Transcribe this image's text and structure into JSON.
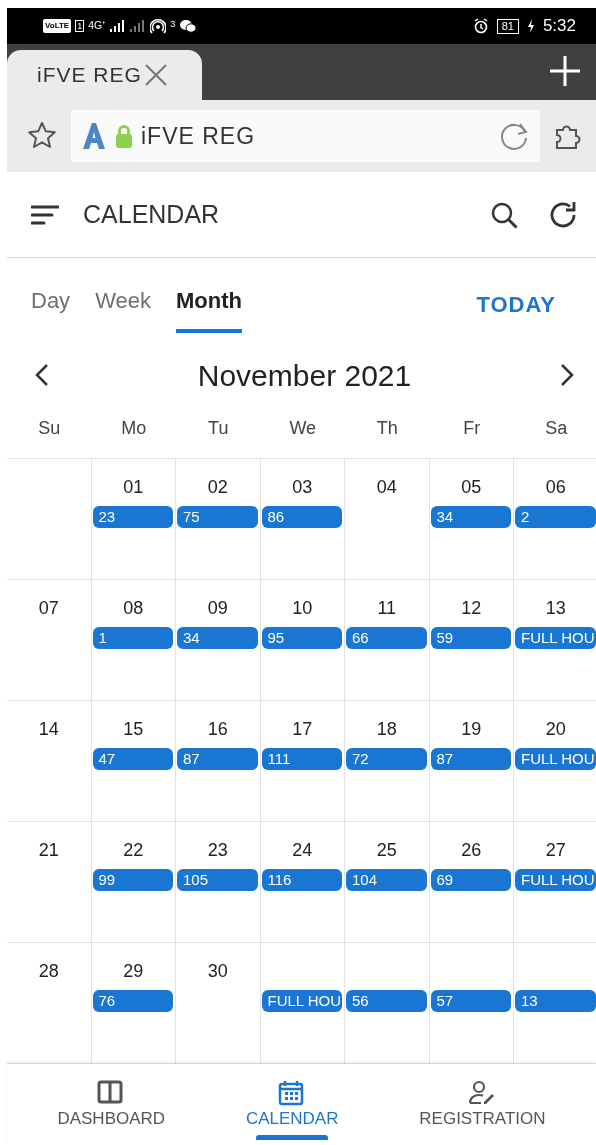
{
  "status_bar": {
    "volte": "VoLTE",
    "sim": "1",
    "network": "4G⁺",
    "hotspot_count": "3",
    "battery": "81",
    "time": "5:32"
  },
  "browser": {
    "tab_title": "iFVE REG",
    "address": "iFVE REG"
  },
  "app_bar": {
    "title": "CALENDAR"
  },
  "view_tabs": [
    {
      "label": "Day",
      "selected": false
    },
    {
      "label": "Week",
      "selected": false
    },
    {
      "label": "Month",
      "selected": true
    }
  ],
  "today_button": "TODAY",
  "month_title": "November 2021",
  "weekdays": [
    "Su",
    "Mo",
    "Tu",
    "We",
    "Th",
    "Fr",
    "Sa"
  ],
  "weeks": [
    [
      {
        "kind": "blank"
      },
      {
        "kind": "day",
        "date": "01",
        "event": "23"
      },
      {
        "kind": "day",
        "date": "02",
        "event": "75"
      },
      {
        "kind": "day",
        "date": "03",
        "event": "86"
      },
      {
        "kind": "day",
        "date": "04"
      },
      {
        "kind": "day",
        "date": "05",
        "event": "34"
      },
      {
        "kind": "day",
        "date": "06",
        "event": "2"
      }
    ],
    [
      {
        "kind": "day",
        "date": "07"
      },
      {
        "kind": "day",
        "date": "08",
        "event": "1"
      },
      {
        "kind": "day",
        "date": "09",
        "event": "34"
      },
      {
        "kind": "day",
        "date": "10",
        "event": "95"
      },
      {
        "kind": "day",
        "date": "11",
        "event": "66"
      },
      {
        "kind": "day",
        "date": "12",
        "event": "59"
      },
      {
        "kind": "day",
        "date": "13",
        "event": "FULL HOU"
      }
    ],
    [
      {
        "kind": "day",
        "date": "14"
      },
      {
        "kind": "day",
        "date": "15",
        "event": "47"
      },
      {
        "kind": "day",
        "date": "16",
        "event": "87"
      },
      {
        "kind": "day",
        "date": "17",
        "event": "111"
      },
      {
        "kind": "day",
        "date": "18",
        "event": "72"
      },
      {
        "kind": "day",
        "date": "19",
        "event": "87"
      },
      {
        "kind": "day",
        "date": "20",
        "event": "FULL HOU"
      }
    ],
    [
      {
        "kind": "day",
        "date": "21"
      },
      {
        "kind": "day",
        "date": "22",
        "event": "99"
      },
      {
        "kind": "day",
        "date": "23",
        "event": "105"
      },
      {
        "kind": "day",
        "date": "24",
        "event": "116"
      },
      {
        "kind": "day",
        "date": "25",
        "event": "104"
      },
      {
        "kind": "day",
        "date": "26",
        "event": "69"
      },
      {
        "kind": "day",
        "date": "27",
        "event": "FULL HOU"
      }
    ],
    [
      {
        "kind": "day",
        "date": "28"
      },
      {
        "kind": "day",
        "date": "29",
        "event": "76"
      },
      {
        "kind": "day",
        "date": "30"
      },
      {
        "kind": "overflow",
        "event": "FULL HOU"
      },
      {
        "kind": "overflow",
        "event": "56"
      },
      {
        "kind": "overflow",
        "event": "57"
      },
      {
        "kind": "overflow",
        "event": "13"
      }
    ]
  ],
  "bottom_nav": [
    {
      "kind": "dashboard",
      "label": "DASHBOARD",
      "selected": false
    },
    {
      "kind": "calendar",
      "label": "CALENDAR",
      "selected": true
    },
    {
      "kind": "registration",
      "label": "REGISTRATION",
      "selected": false
    }
  ]
}
